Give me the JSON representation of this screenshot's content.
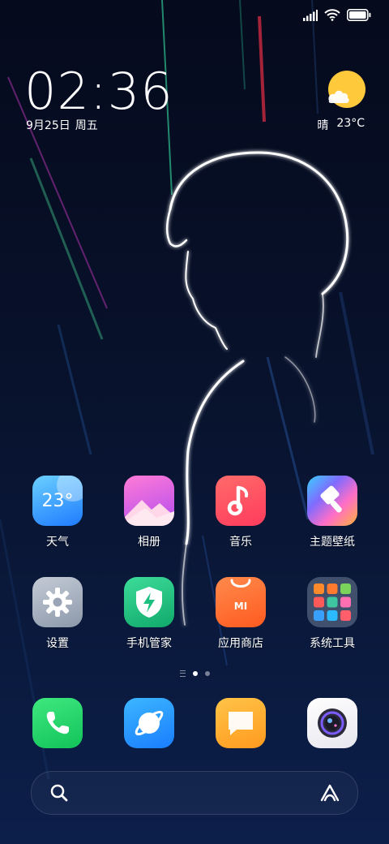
{
  "status_bar": {
    "signal_icon": "signal-bars-icon",
    "wifi_icon": "wifi-icon",
    "battery_icon": "battery-icon"
  },
  "clock_widget": {
    "time": "02:36",
    "date": "9月25日",
    "weekday": "周五"
  },
  "weather_widget": {
    "icon": "sun-cloud-icon",
    "condition": "晴",
    "temperature": "23°C"
  },
  "apps": [
    {
      "label": "天气",
      "icon": "weather-app-icon",
      "badge_text": "23°",
      "color": "#2f8cff"
    },
    {
      "label": "相册",
      "icon": "gallery-app-icon",
      "color": "#e65cc4"
    },
    {
      "label": "音乐",
      "icon": "music-app-icon",
      "color": "#ff4d5e"
    },
    {
      "label": "主题壁纸",
      "icon": "themes-app-icon",
      "color": "#ff7a45"
    },
    {
      "label": "设置",
      "icon": "gear-icon",
      "color": "#8e9aa8"
    },
    {
      "label": "手机管家",
      "icon": "security-shield-icon",
      "color": "#18b77f"
    },
    {
      "label": "应用商店",
      "icon": "app-store-bag-icon",
      "badge_text": "MI",
      "color": "#ff6a2a"
    },
    {
      "label": "系统工具",
      "icon": "folder-icon",
      "color": "#4a5a73"
    }
  ],
  "page_indicator": {
    "pages": 2,
    "active_page": 1
  },
  "dock": [
    {
      "name": "phone",
      "icon": "phone-icon",
      "color": "#1fd26b"
    },
    {
      "name": "browser",
      "icon": "browser-planet-icon",
      "color": "#1a96ff"
    },
    {
      "name": "messages",
      "icon": "message-bubble-icon",
      "color": "#ffb32a"
    },
    {
      "name": "camera",
      "icon": "camera-lens-icon",
      "color": "#f2f2f5"
    }
  ],
  "search_bar": {
    "search_icon": "search-icon",
    "assistant_icon": "assistant-icon"
  }
}
